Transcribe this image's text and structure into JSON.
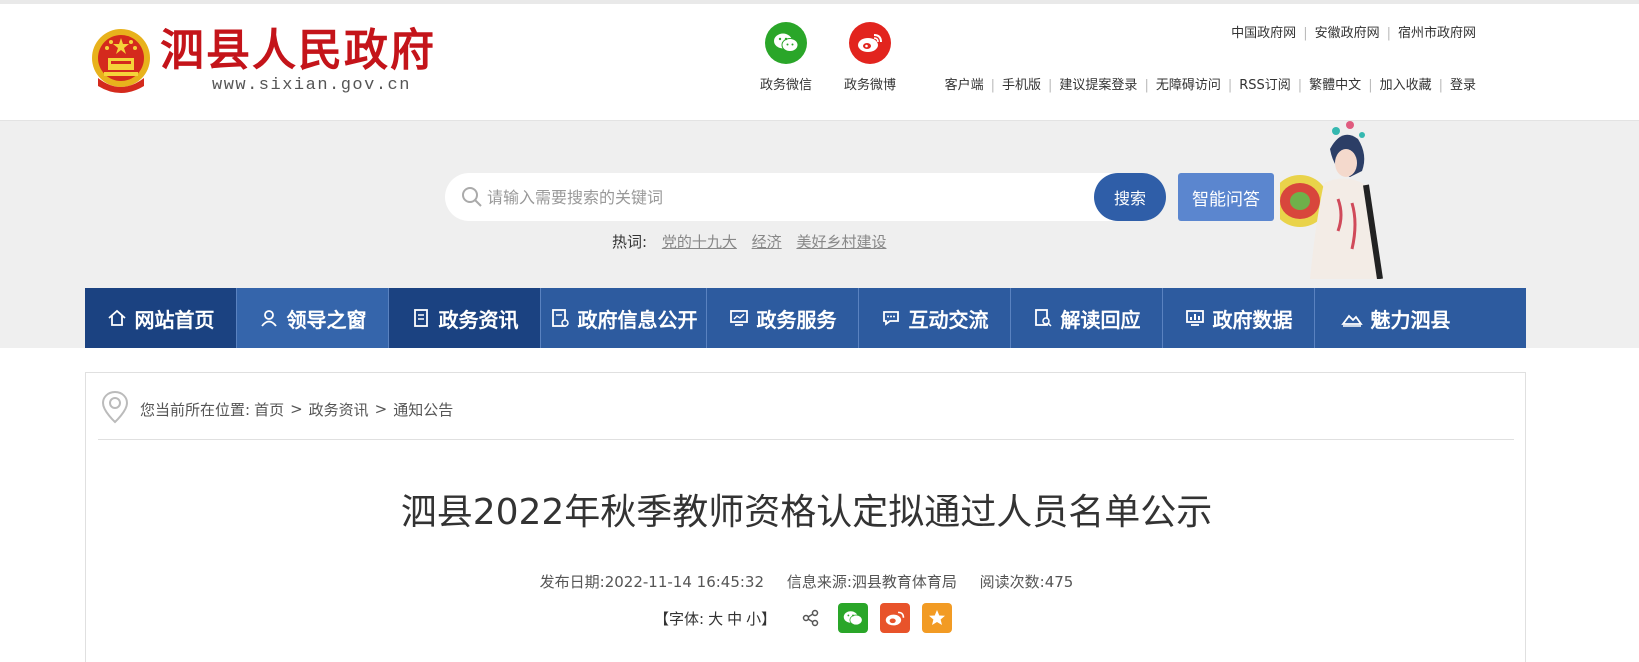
{
  "header": {
    "site_name": "泗县人民政府",
    "site_url": "www.sixian.gov.cn",
    "social": [
      {
        "label": "政务微信",
        "icon": "wechat-icon",
        "color": "#2aa629"
      },
      {
        "label": "政务微博",
        "icon": "weibo-icon",
        "color": "#e2241e"
      }
    ],
    "gov_links": [
      "中国政府网",
      "安徽政府网",
      "宿州市政府网"
    ],
    "util_links": [
      "客户端",
      "手机版",
      "建议提案登录",
      "无障碍访问",
      "RSS订阅",
      "繁體中文",
      "加入收藏",
      "登录"
    ]
  },
  "search": {
    "placeholder": "请输入需要搜索的关键词",
    "button": "搜索",
    "qa_button": "智能问答",
    "hot_label": "热词:",
    "hot_words": [
      "党的十九大",
      "经济",
      "美好乡村建设"
    ]
  },
  "nav": [
    {
      "label": "网站首页",
      "icon": "home-icon"
    },
    {
      "label": "领导之窗",
      "icon": "user-icon"
    },
    {
      "label": "政务资讯",
      "icon": "document-icon"
    },
    {
      "label": "政府信息公开",
      "icon": "info-doc-icon"
    },
    {
      "label": "政务服务",
      "icon": "monitor-icon"
    },
    {
      "label": "互动交流",
      "icon": "chat-icon"
    },
    {
      "label": "解读回应",
      "icon": "search-doc-icon"
    },
    {
      "label": "政府数据",
      "icon": "chart-icon"
    },
    {
      "label": "魅力泗县",
      "icon": "landscape-icon"
    }
  ],
  "breadcrumb": {
    "prefix": "您当前所在位置:",
    "items": [
      "首页",
      "政务资讯",
      "通知公告"
    ]
  },
  "article": {
    "title": "泗县2022年秋季教师资格认定拟通过人员名单公示",
    "date_label": "发布日期:2022-11-14 16:45:32",
    "source_label": "信息来源:泗县教育体育局",
    "views_label": "阅读次数:475",
    "font_label": "【字体:",
    "font_sizes": [
      "大",
      "中",
      "小"
    ],
    "font_close": "】"
  },
  "colors": {
    "brand_red": "#c4141a",
    "nav_blue": "#2d5b9f",
    "nav_active": "#1b4281",
    "search_btn": "#2f5ea8",
    "qa_btn": "#5b86cf",
    "share_wechat": "#2aa629",
    "share_weibo": "#e8532a",
    "share_fav": "#f29b24"
  }
}
